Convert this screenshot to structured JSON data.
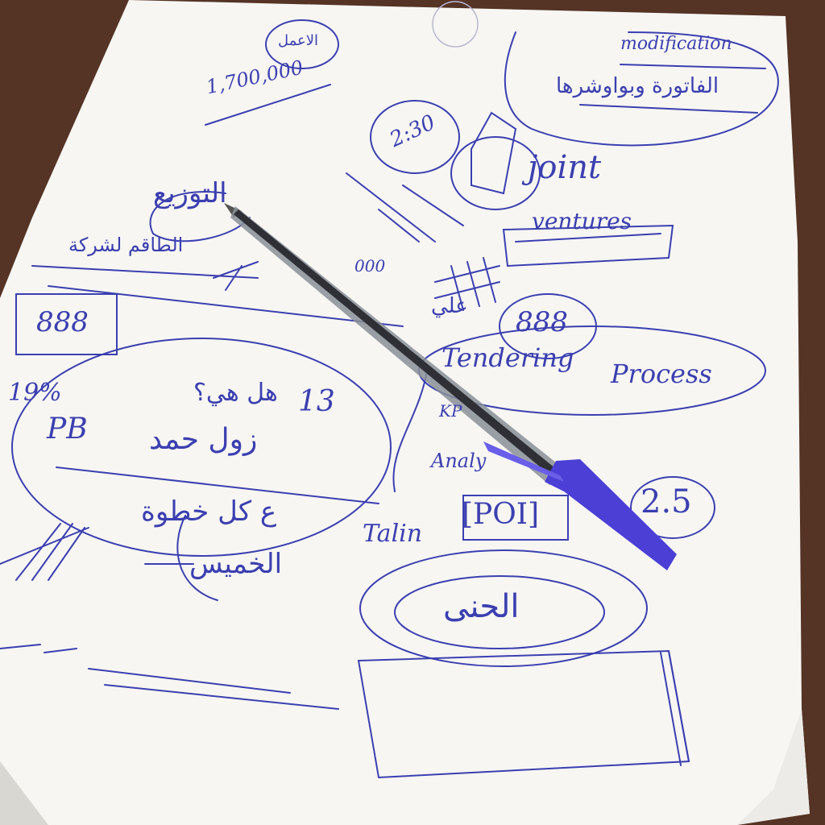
{
  "colors": {
    "table": "#4a2c1f",
    "paper": "#f7f6f3",
    "ink": "#3b3fb0",
    "pen_cap": "#4b3fd6"
  },
  "notes": {
    "circled_top": "الاعمل",
    "amount": "1,700,000",
    "time": "2:30",
    "joint": "joint",
    "ventures": "ventures",
    "modification": "modification",
    "arabic_top_right": "الفاتورة وبواوشرها",
    "distribution": "التوزيع",
    "quarter_seven": "الطاقم لشركة",
    "boxed_number": "888",
    "percent": "19%",
    "pb": "PB",
    "q_question": "هل هي؟",
    "count": "13",
    "ahmad": "زول حمد",
    "each_step": "ع كل خطوة",
    "thursday": "الخميس",
    "ali": "علي",
    "tendering": "Tendering",
    "process": "Process",
    "analy": "Analy",
    "kpi": "KP",
    "talin": "Talin",
    "poi": "[POI]",
    "score": "2.5",
    "circle_bottom": "الحنى",
    "thousands": "000",
    "circled_888": "888"
  },
  "icons": {
    "pen": "ballpoint-pen-icon",
    "seal": "seal-icon"
  }
}
